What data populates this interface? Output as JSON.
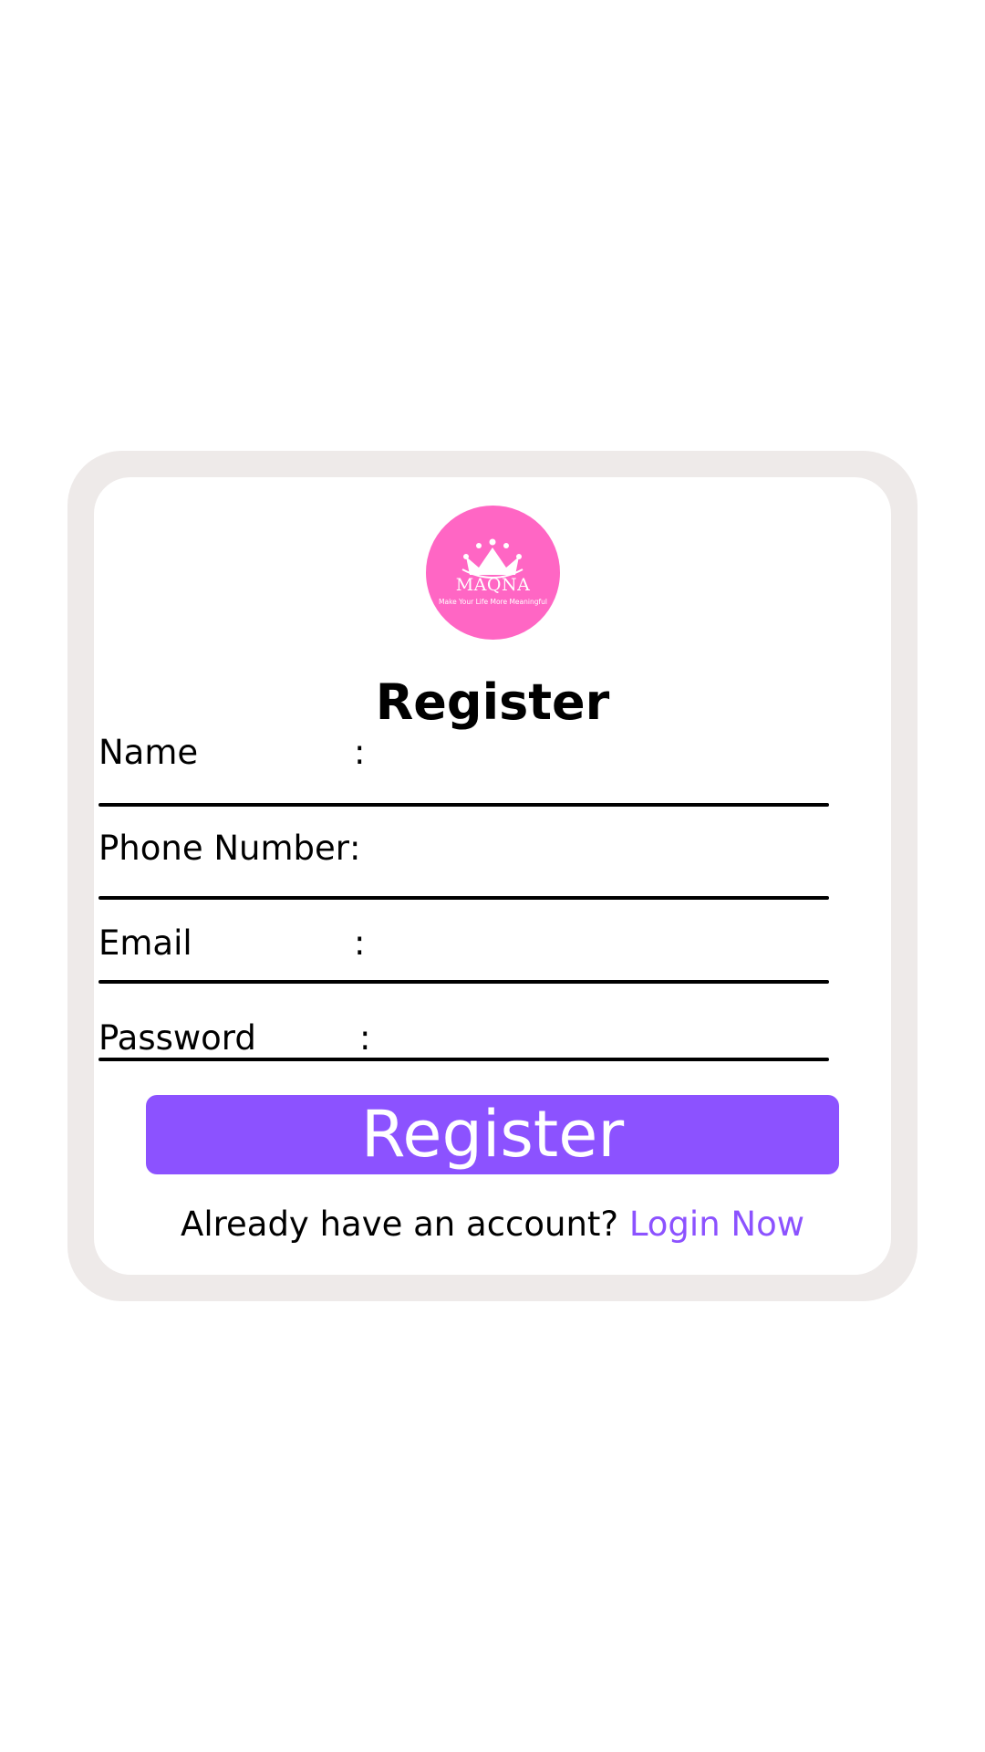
{
  "logo": {
    "name": "MAQNA",
    "tagline": "Make Your Life More Meaningful",
    "icon": "crown-icon",
    "color": "#ff66c4"
  },
  "form": {
    "title": "Register",
    "fields": [
      {
        "label": "Name",
        "colon": ":"
      },
      {
        "label": "Phone Number",
        "colon": ":"
      },
      {
        "label": "Email",
        "colon": ":"
      },
      {
        "label": "Password",
        "colon": ":"
      }
    ],
    "submit_label": "Register",
    "footer_text": "Already have an account? ",
    "login_link": "Login Now"
  },
  "colors": {
    "accent": "#8c52ff",
    "frame": "#eeeae9"
  }
}
